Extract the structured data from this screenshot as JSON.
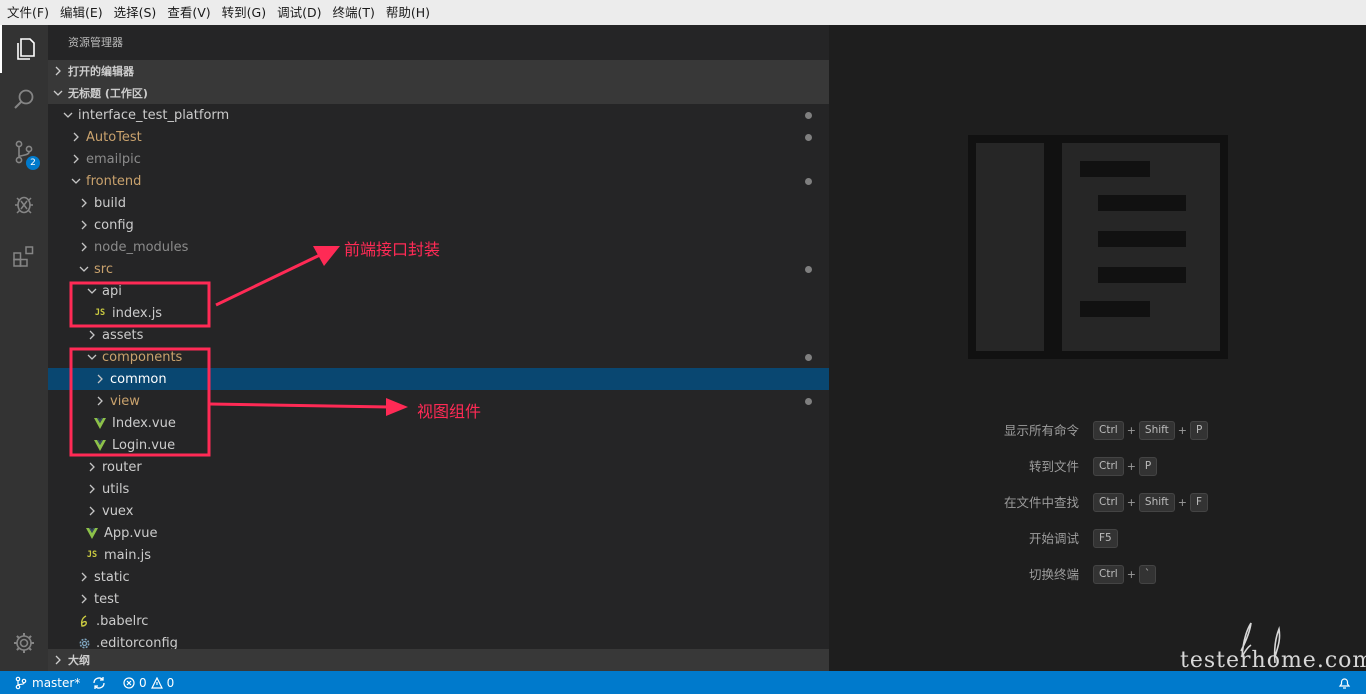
{
  "menubar": {
    "items": [
      "文件(F)",
      "编辑(E)",
      "选择(S)",
      "查看(V)",
      "转到(G)",
      "调试(D)",
      "终端(T)",
      "帮助(H)"
    ]
  },
  "activitybar": {
    "items": [
      {
        "icon": "files-icon",
        "active": true
      },
      {
        "icon": "search-icon",
        "active": false
      },
      {
        "icon": "source-control-icon",
        "active": false,
        "badge": "2"
      },
      {
        "icon": "debug-icon",
        "active": false
      },
      {
        "icon": "extensions-icon",
        "active": false
      },
      {
        "icon": "gear-icon",
        "active": false
      }
    ]
  },
  "sidebar": {
    "title": "资源管理器",
    "sections": {
      "open_editors": "打开的编辑器",
      "workspace": "无标题 (工作区)",
      "outline": "大纲"
    },
    "tree": [
      {
        "name": "interface_test_platform",
        "depth": 0,
        "type": "folder",
        "open": true,
        "dot": true
      },
      {
        "name": "AutoTest",
        "depth": 1,
        "type": "folder",
        "open": false,
        "dot": true,
        "color": "mod"
      },
      {
        "name": "emailpic",
        "depth": 1,
        "type": "folder",
        "open": false,
        "color": "dim"
      },
      {
        "name": "frontend",
        "depth": 1,
        "type": "folder",
        "open": true,
        "dot": true,
        "color": "mod"
      },
      {
        "name": "build",
        "depth": 2,
        "type": "folder",
        "open": false
      },
      {
        "name": "config",
        "depth": 2,
        "type": "folder",
        "open": false
      },
      {
        "name": "node_modules",
        "depth": 2,
        "type": "folder",
        "open": false,
        "color": "dim"
      },
      {
        "name": "src",
        "depth": 2,
        "type": "folder",
        "open": true,
        "dot": true,
        "color": "mod"
      },
      {
        "name": "api",
        "depth": 3,
        "type": "folder",
        "open": true
      },
      {
        "name": "index.js",
        "depth": 4,
        "type": "js"
      },
      {
        "name": "assets",
        "depth": 3,
        "type": "folder",
        "open": false
      },
      {
        "name": "components",
        "depth": 3,
        "type": "folder",
        "open": true,
        "dot": true,
        "color": "mod"
      },
      {
        "name": "common",
        "depth": 4,
        "type": "folder",
        "open": false,
        "selected": true,
        "color": "white"
      },
      {
        "name": "view",
        "depth": 4,
        "type": "folder",
        "open": false,
        "dot": true,
        "color": "mod"
      },
      {
        "name": "Index.vue",
        "depth": 4,
        "type": "vue"
      },
      {
        "name": "Login.vue",
        "depth": 4,
        "type": "vue"
      },
      {
        "name": "router",
        "depth": 3,
        "type": "folder",
        "open": false
      },
      {
        "name": "utils",
        "depth": 3,
        "type": "folder",
        "open": false
      },
      {
        "name": "vuex",
        "depth": 3,
        "type": "folder",
        "open": false
      },
      {
        "name": "App.vue",
        "depth": 3,
        "type": "vue"
      },
      {
        "name": "main.js",
        "depth": 3,
        "type": "js"
      },
      {
        "name": "static",
        "depth": 2,
        "type": "folder",
        "open": false
      },
      {
        "name": "test",
        "depth": 2,
        "type": "folder",
        "open": false
      },
      {
        "name": ".babelrc",
        "depth": 2,
        "type": "babel"
      },
      {
        "name": ".editorconfig",
        "depth": 2,
        "type": "config"
      }
    ]
  },
  "annotations": {
    "api_note": "前端接口封装",
    "components_note": "视图组件"
  },
  "editor": {
    "shortcuts": [
      {
        "label": "显示所有命令",
        "keys": [
          "Ctrl",
          "Shift",
          "P"
        ]
      },
      {
        "label": "转到文件",
        "keys": [
          "Ctrl",
          "P"
        ]
      },
      {
        "label": "在文件中查找",
        "keys": [
          "Ctrl",
          "Shift",
          "F"
        ]
      },
      {
        "label": "开始调试",
        "keys": [
          "F5"
        ]
      },
      {
        "label": "切换终端",
        "keys": [
          "Ctrl",
          "`"
        ]
      }
    ],
    "site": "testerhome.com"
  },
  "statusbar": {
    "branch": "master*",
    "errors": "0",
    "warnings": "0"
  },
  "colors": {
    "accent": "#007acc",
    "selection": "#094771",
    "annotation": "#ff2a55",
    "modified": "#c9a26d"
  }
}
